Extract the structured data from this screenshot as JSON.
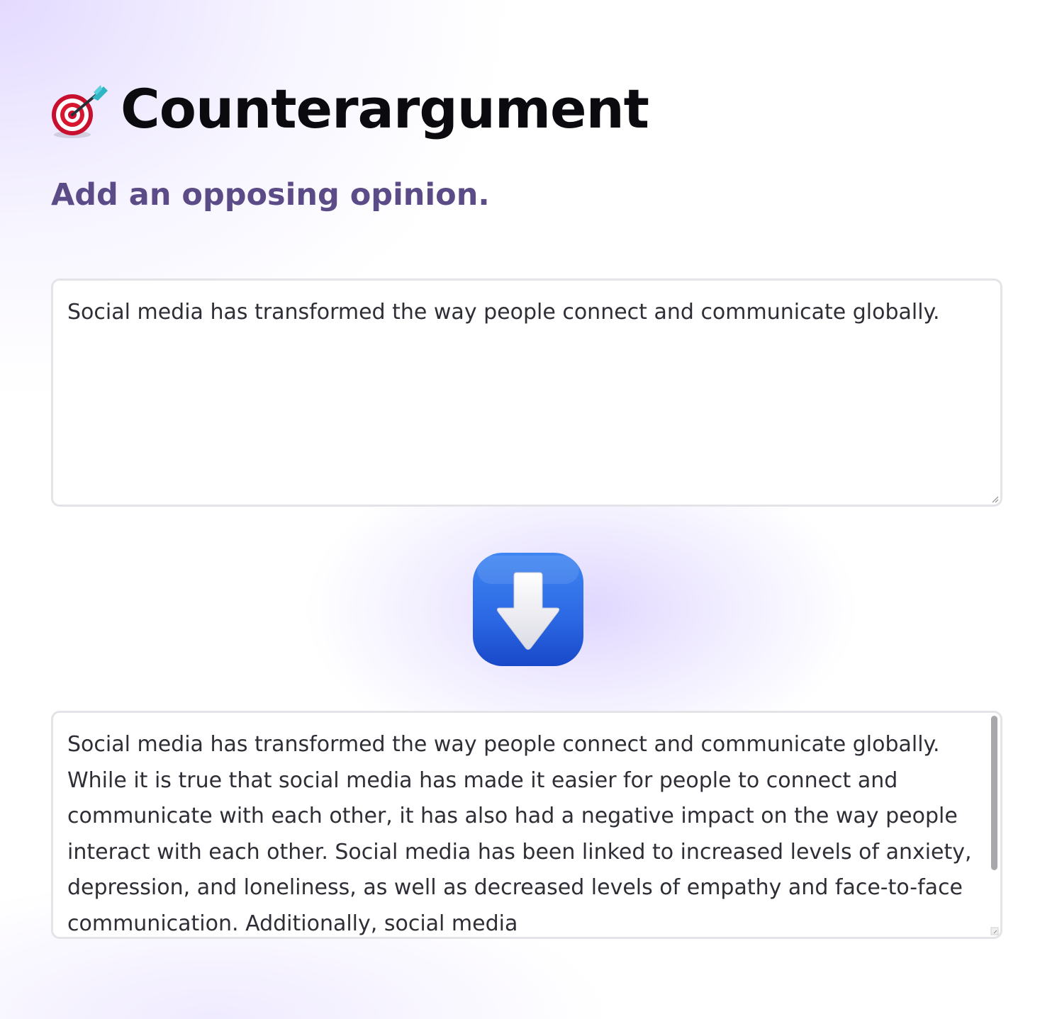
{
  "header": {
    "icon": "direct-hit-target-icon",
    "title": "Counterargument"
  },
  "subtitle": "Add an opposing opinion.",
  "input": {
    "value": "Social media has transformed the way people connect and communicate globally."
  },
  "action": {
    "icon": "down-arrow-icon",
    "accent_color": "#2f6be8"
  },
  "output": {
    "value": "Social media has transformed the way people connect and communicate globally.  While it is true that social media has made it easier for people to connect and communicate with each other, it has also had a negative impact on the way people interact with each other. Social media has been linked to increased levels of anxiety, depression, and loneliness, as well as decreased levels of empathy and face-to-face communication. Additionally, social media"
  }
}
